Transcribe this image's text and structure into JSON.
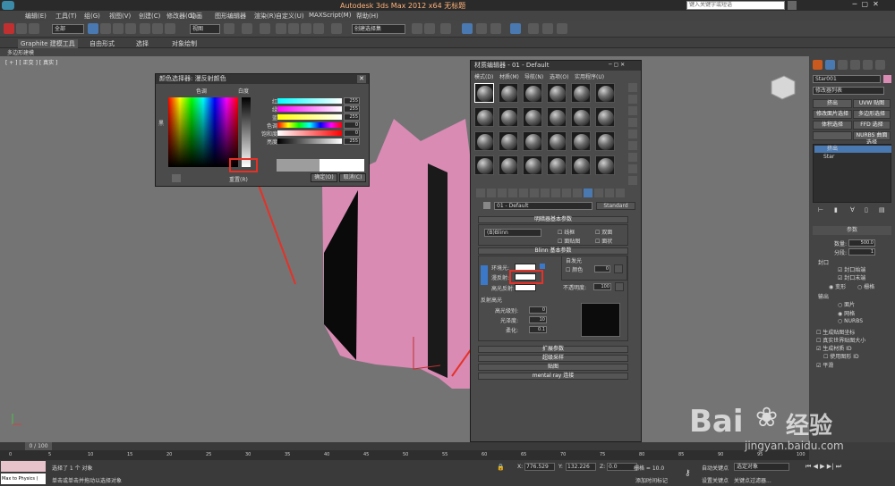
{
  "title_bar": {
    "title": "Autodesk 3ds Max 2012 x64 无标题",
    "search_placeholder": "键入关键字或短语"
  },
  "menu": [
    "编辑(E)",
    "工具(T)",
    "组(G)",
    "视图(V)",
    "创建(C)",
    "修改器(O)",
    "动画",
    "图形编辑器",
    "渲染(R)",
    "自定义(U)",
    "MAXScript(M)",
    "帮助(H)"
  ],
  "toolbar": {
    "filter_value": "全部",
    "view_value": "视图",
    "selection_set": "创建选择集"
  },
  "ribbon": {
    "tabs": [
      "Graphite 建模工具",
      "自由形式",
      "选择",
      "对象绘制"
    ],
    "sub_label": "多边形建模"
  },
  "viewport": {
    "label": "[ + ] [ 正交 ] [ 真实 ]"
  },
  "color_picker": {
    "title": "颜色选择器: 漫反射颜色",
    "hue_label": "色调",
    "white_label": "白度",
    "black_label": "黑",
    "channels": [
      {
        "label": "红:",
        "value": "255"
      },
      {
        "label": "绿:",
        "value": "255"
      },
      {
        "label": "蓝:",
        "value": "255"
      },
      {
        "label": "色调:",
        "value": "0"
      },
      {
        "label": "饱和度:",
        "value": "0"
      },
      {
        "label": "亮度:",
        "value": "255"
      }
    ],
    "reset_label": "重置(R)",
    "ok_label": "确定(O)",
    "cancel_label": "取消(C)"
  },
  "mat_editor": {
    "title": "材质编辑器 - 01 - Default",
    "menus": [
      "模式(D)",
      "材质(M)",
      "导航(N)",
      "选项(O)",
      "实用程序(U)"
    ],
    "material_name": "01 - Default",
    "material_type": "Standard",
    "shader_rollout": "明暗器基本参数",
    "shader": "(B)Blinn",
    "shader_options": [
      "线框",
      "双面",
      "面贴图",
      "面状"
    ],
    "blinn_rollout": "Blinn 基本参数",
    "self_illum": "自发光",
    "color_label": "颜色",
    "color_value": "0",
    "ambient_label": "环境光:",
    "diffuse_label": "漫反射:",
    "specular_label": "高光反射:",
    "opacity_label": "不透明度:",
    "opacity_value": "100",
    "spec_hl_label": "反射高光",
    "spec_level_label": "高光级别:",
    "spec_level_value": "0",
    "gloss_label": "光泽度:",
    "gloss_value": "10",
    "soften_label": "柔化:",
    "soften_value": "0.1",
    "rollouts": [
      "扩展参数",
      "超级采样",
      "贴图",
      "mental ray 连接"
    ]
  },
  "command_panel": {
    "object_name": "Star001",
    "modifier_list": "修改器列表",
    "buttons": [
      "挤出",
      "UVW 贴图",
      "修改面片选择",
      "多边形选择",
      "体积选择",
      "FFD 选择",
      "",
      "NURBS 曲面选择"
    ],
    "stack": [
      "挤出",
      "Star"
    ],
    "params_header": "参数",
    "amount_label": "数量:",
    "amount_value": "500.0",
    "segments_label": "分段:",
    "segments_value": "1",
    "capping_label": "封口",
    "cap_start": "封口始端",
    "cap_end": "封口末端",
    "morph": "变形",
    "grid": "栅格",
    "output_label": "输出",
    "output_options": [
      "面片",
      "网格",
      "NURBS"
    ],
    "gen_map_coords": "生成贴图坐标",
    "real_world": "真实世界贴图大小",
    "gen_mat_ids": "生成材质 ID",
    "use_shape_ids": "使用图形 ID",
    "smooth": "平滑"
  },
  "timeline": {
    "frame": "0 / 100",
    "ticks": [
      "0",
      "5",
      "10",
      "15",
      "20",
      "25",
      "30",
      "35",
      "40",
      "45",
      "50",
      "55",
      "60",
      "65",
      "70",
      "75",
      "80",
      "85",
      "90",
      "95",
      "100"
    ]
  },
  "status": {
    "maxscript": "Max to Physics (",
    "selected": "选择了 1 个 对象",
    "hint": "单击或单击并拖动以选择对象",
    "x_label": "X:",
    "x_value": "776.529",
    "y_label": "Y:",
    "y_value": "132.226",
    "z_label": "Z:",
    "z_value": "0.0",
    "grid": "栅格 = 10.0",
    "add_time_tag": "添加时间标记",
    "auto_key": "自动关键点",
    "key_target": "选定对象",
    "set_key": "设置关键点",
    "key_filters": "关键点过滤器..."
  },
  "watermark": {
    "brand": "Bai",
    "brand2": "经验",
    "url": "jingyan.baidu.com"
  },
  "colors": {
    "pink": "#d98bb4",
    "viewport": "#747474",
    "highlight": "#e53127"
  }
}
